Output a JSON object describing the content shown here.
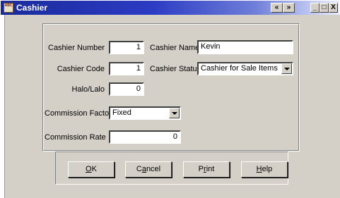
{
  "window": {
    "title": "Cashier",
    "icon": "cashier-app-icon",
    "icon_text": "ABC"
  },
  "titlebar_buttons": {
    "prev": "«",
    "next": "»",
    "minimize": "_",
    "maximize": "□",
    "close": "X"
  },
  "form": {
    "cashier_number": {
      "label": "Cashier Number",
      "value": "1"
    },
    "cashier_name": {
      "label": "Cashier Name",
      "value": "Kevin"
    },
    "cashier_code": {
      "label": "Cashier Code",
      "value": "1"
    },
    "cashier_status": {
      "label": "Cashier Status",
      "value": "Cashier for Sale Items"
    },
    "halo_lalo": {
      "label": "Halo/Lalo",
      "value": "0"
    },
    "commission_factor": {
      "label": "Commission Factor",
      "value": "Fixed"
    },
    "commission_rate": {
      "label": "Commission Rate",
      "value": "0"
    }
  },
  "buttons": {
    "ok": {
      "mn": "O",
      "rest": "K"
    },
    "cancel": {
      "pre": "C",
      "mn": "a",
      "rest": "ncel"
    },
    "print": {
      "pre": "P",
      "mn": "r",
      "rest": "int"
    },
    "help": {
      "mn": "H",
      "rest": "elp"
    }
  }
}
